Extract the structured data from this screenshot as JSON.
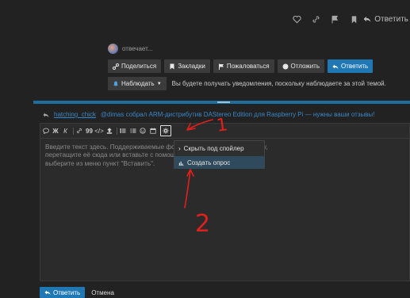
{
  "post_actions": {
    "icons": [
      "heart-icon",
      "link-icon",
      "flag-icon",
      "bookmark-icon"
    ],
    "reply_label": "Ответить"
  },
  "typing": {
    "text": "отвечает..."
  },
  "buttons": {
    "share": "Поделиться",
    "bookmarks": "Закладки",
    "flag": "Пожаловаться",
    "defer": "Отложить",
    "reply": "Ответить"
  },
  "notification": {
    "label": "Наблюдать",
    "text": "Вы будете получать уведомления, поскольку наблюдаете за этой темой."
  },
  "composer": {
    "reply_to_user": "hatching_chick",
    "reply_to_title": "@dimas собрал ARM-дистрибутив DAStereo Edition для Raspberry Pi — нужны ваши отзывы!",
    "toolbar": {
      "bold": "Ж",
      "italic": "К",
      "quote": "99"
    },
    "placeholder_lines": [
      "Введите текст здесь. Поддерживаемые форматы...                                              лы вставить картинку,",
      "перетащите её сюда или вставьте с помощью Ct...                                             авой кнопкой мыши и",
      "выберите из меню пункт \"Вставить\"."
    ],
    "dropdown": {
      "items": [
        "Скрыть под спойлер",
        "Создать опрос"
      ]
    },
    "submit_label": "Ответить",
    "cancel_label": "Отмена"
  },
  "annotations": {
    "label_1": "1",
    "label_2": "2",
    "color": "#e0201c"
  },
  "colors": {
    "accent": "#1f78b4",
    "background": "#222222"
  }
}
